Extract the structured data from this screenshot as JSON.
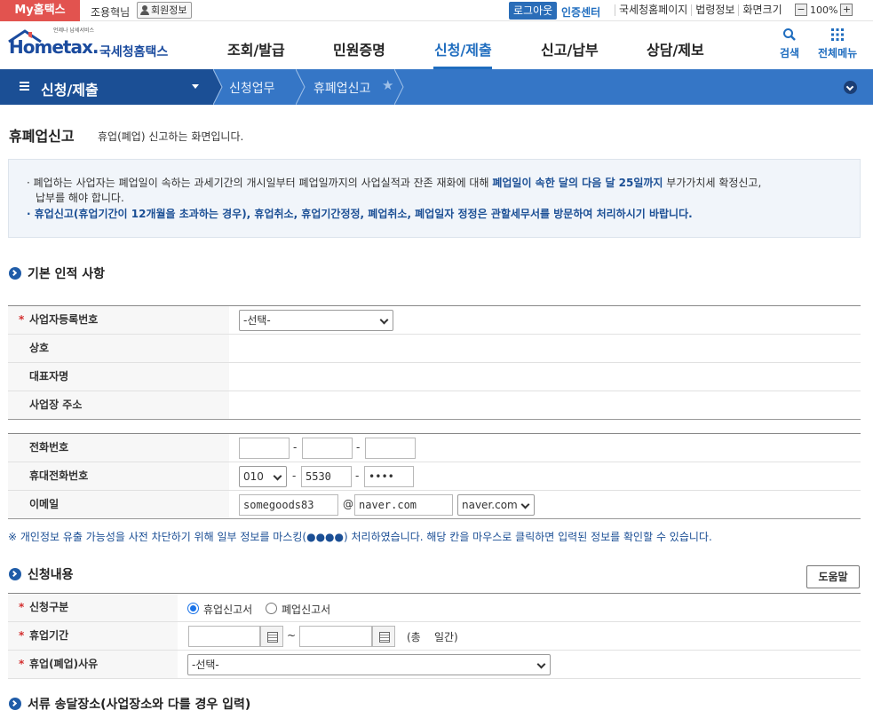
{
  "topbar": {
    "my_home": "My홈택스",
    "username": "조용혁님",
    "member_info": "회원정보",
    "logout": "로그아웃",
    "cert_center": "인증센터",
    "links": [
      "국세청홈페이지",
      "법령정보",
      "화면크기"
    ],
    "zoom_minus": "−",
    "zoom_value": "100%",
    "zoom_plus": "+"
  },
  "header": {
    "logo_tagline": "언제나 납세서비스",
    "logo_word": "Hometax.",
    "logo_kr": "국세청홈택스",
    "menu": [
      "조회/발급",
      "민원증명",
      "신청/제출",
      "신고/납부",
      "상담/제보"
    ],
    "search_label": "검색",
    "all_menu_label": "전체메뉴"
  },
  "navbar": {
    "section": "신청/제출",
    "crumbs": [
      "신청업무",
      "휴폐업신고"
    ]
  },
  "page": {
    "title": "휴폐업신고",
    "desc": "휴업(폐업) 신고하는 화면입니다."
  },
  "notice": {
    "line1_a": "폐업하는 사업자는 폐업일이 속하는 과세기간의 개시일부터 폐업일까지의 사업실적과 잔존 재화에 대해 ",
    "line1_b": "폐업일이 속한 달의 다음 달 25일까지",
    "line1_c": " 부가가치세 확정신고,",
    "line2": "납부를 해야 합니다.",
    "line3": "휴업신고(휴업기간이 12개월을 초과하는 경우), 휴업취소, 휴업기간정정, 폐업취소, 폐업일자 정정은 관할세무서를 방문하여 처리하시기 바랍니다."
  },
  "basic": {
    "heading": "기본 인적 사항",
    "bizno_label": "사업자등록번호",
    "bizno_value": "-선택-",
    "trade_label": "상호",
    "rep_label": "대표자명",
    "addr_label": "사업장 주소",
    "phone_label": "전화번호",
    "mobile_label": "휴대전화번호",
    "mobile_1": "010",
    "mobile_2": "5530",
    "mobile_3": "••••",
    "email_label": "이메일",
    "email_id": "somegoods83",
    "email_at": "@",
    "email_domain": "naver.com",
    "email_select": "naver.com",
    "dash": "-"
  },
  "privacy_note": "※ 개인정보 유출 가능성을 사전 차단하기 위해 일부 정보를 마스킹(●●●●) 처리하였습니다. 해당 칸을 마우스로 클릭하면 입력된 정보를 확인할 수 있습니다.",
  "request": {
    "heading": "신청내용",
    "help": "도움말",
    "type_label": "신청구분",
    "type_opt1": "휴업신고서",
    "type_opt2": "폐업신고서",
    "period_label": "휴업기간",
    "tilde": "~",
    "total_days": "(총    일간)",
    "reason_label": "휴업(폐업)사유",
    "reason_value": "-선택-"
  },
  "delivery": {
    "heading": "서류 송달장소(사업장소와 다를 경우 입력)"
  },
  "colors": {
    "brand_red": "#e2534f",
    "brand_blue": "#1f6dbf",
    "nav_blue": "#3576c6",
    "nav_dark": "#1b4f95"
  }
}
